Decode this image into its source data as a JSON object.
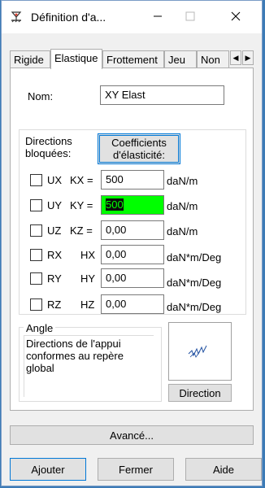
{
  "window": {
    "title": "Définition d'a...",
    "icon": "support-icon",
    "controls": {
      "minimize": "—",
      "maximize": "☐",
      "close": "✕"
    }
  },
  "tabs": [
    {
      "label": "Rigide",
      "active": false
    },
    {
      "label": "Elastique",
      "active": true
    },
    {
      "label": "Frottement",
      "active": false
    },
    {
      "label": "Jeu",
      "active": false
    },
    {
      "label": "Non",
      "active": false
    }
  ],
  "tab_scroll": {
    "left": "◀",
    "right": "▶"
  },
  "name": {
    "label": "Nom:",
    "value": "XY Elast"
  },
  "directions": {
    "label_line1": "Directions",
    "label_line2": "bloquées:",
    "coef_button_line1": "Coefficients",
    "coef_button_line2": "d'élasticité:",
    "rows": [
      {
        "dir": "UX",
        "coef": "KX =",
        "value": "500",
        "unit": "daN/m",
        "checked": false,
        "highlight": false
      },
      {
        "dir": "UY",
        "coef": "KY =",
        "value": "500",
        "unit": "daN/m",
        "checked": false,
        "highlight": true
      },
      {
        "dir": "UZ",
        "coef": "KZ =",
        "value": "0,00",
        "unit": "daN/m",
        "checked": false,
        "highlight": false
      },
      {
        "dir": "RX",
        "coef": "HX",
        "value": "0,00",
        "unit": "daN*m/Deg",
        "checked": false,
        "highlight": false
      },
      {
        "dir": "RY",
        "coef": "HY",
        "value": "0,00",
        "unit": "daN*m/Deg",
        "checked": false,
        "highlight": false
      },
      {
        "dir": "RZ",
        "coef": "HZ",
        "value": "0,00",
        "unit": "daN*m/Deg",
        "checked": false,
        "highlight": false
      }
    ]
  },
  "angle": {
    "label": "Angle",
    "text_line1": "Directions de l'appui",
    "text_line2": "conformes au repère",
    "text_line3": "global",
    "preview_icon": "axis-direction-icon",
    "direction_button": "Direction"
  },
  "buttons": {
    "advanced": "Avancé...",
    "add": "Ajouter",
    "close": "Fermer",
    "help": "Aide"
  },
  "colors": {
    "highlight_input": "#00ff00",
    "focus_border": "#0078d7",
    "desktop": "#3d7bb6"
  }
}
